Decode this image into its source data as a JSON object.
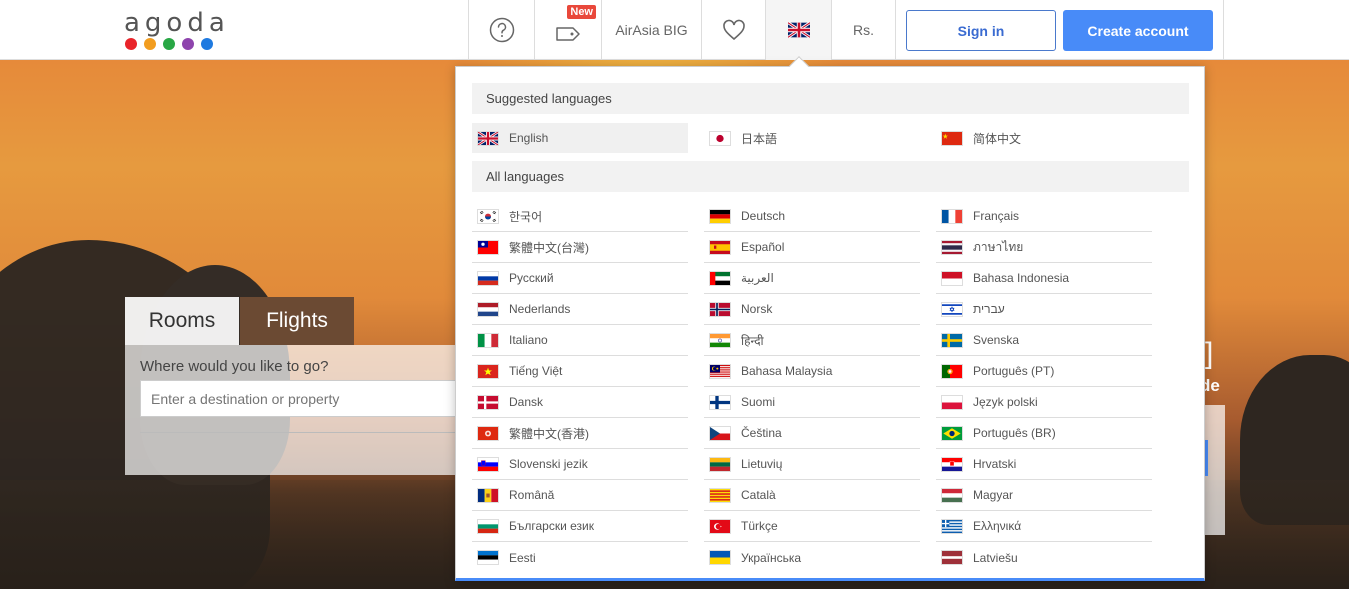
{
  "header": {
    "logo": "agoda",
    "logo_dot_colors": [
      "#e9242a",
      "#f29d1f",
      "#28a745",
      "#8e44ad",
      "#1f7ae0"
    ],
    "help_icon": "question-icon",
    "deals_icon": "tag-icon",
    "deals_badge": "New",
    "airasia_label": "AirAsia BIG",
    "favorites_icon": "heart-icon",
    "language_icon": "uk-flag-icon",
    "currency_label": "Rs.",
    "signin_label": "Sign in",
    "create_label": "Create account"
  },
  "search": {
    "tabs": [
      "Rooms",
      "Flights"
    ],
    "where_label": "Where would you like to go?",
    "destination_placeholder": "Enter a destination or property"
  },
  "hero_right": {
    "text1": "]",
    "text2": "de"
  },
  "dropdown": {
    "suggested_title": "Suggested languages",
    "all_title": "All languages",
    "suggested": [
      {
        "label": "English",
        "flag": "gb",
        "selected": true
      },
      {
        "label": "日本語",
        "flag": "jp"
      },
      {
        "label": "简体中文",
        "flag": "cn"
      }
    ],
    "columns": [
      [
        {
          "label": "한국어",
          "flag": "kr"
        },
        {
          "label": "繁體中文(台灣)",
          "flag": "tw"
        },
        {
          "label": "Русский",
          "flag": "ru"
        },
        {
          "label": "Nederlands",
          "flag": "nl"
        },
        {
          "label": "Italiano",
          "flag": "it"
        },
        {
          "label": "Tiếng Việt",
          "flag": "vn"
        },
        {
          "label": "Dansk",
          "flag": "dk"
        },
        {
          "label": "繁體中文(香港)",
          "flag": "hk"
        },
        {
          "label": "Slovenski jezik",
          "flag": "si"
        },
        {
          "label": "Română",
          "flag": "ro"
        },
        {
          "label": "Български език",
          "flag": "bg"
        },
        {
          "label": "Eesti",
          "flag": "ee"
        }
      ],
      [
        {
          "label": "Deutsch",
          "flag": "de"
        },
        {
          "label": "Español",
          "flag": "es"
        },
        {
          "label": "العربية",
          "flag": "ae"
        },
        {
          "label": "Norsk",
          "flag": "no"
        },
        {
          "label": "हिन्दी",
          "flag": "in"
        },
        {
          "label": "Bahasa Malaysia",
          "flag": "my"
        },
        {
          "label": "Suomi",
          "flag": "fi"
        },
        {
          "label": "Čeština",
          "flag": "cz"
        },
        {
          "label": "Lietuvių",
          "flag": "lt"
        },
        {
          "label": "Català",
          "flag": "ct"
        },
        {
          "label": "Türkçe",
          "flag": "tr"
        },
        {
          "label": "Українська",
          "flag": "ua"
        }
      ],
      [
        {
          "label": "Français",
          "flag": "fr"
        },
        {
          "label": "ภาษาไทย",
          "flag": "th"
        },
        {
          "label": "Bahasa Indonesia",
          "flag": "id"
        },
        {
          "label": "עברית",
          "flag": "il"
        },
        {
          "label": "Svenska",
          "flag": "se"
        },
        {
          "label": "Português (PT)",
          "flag": "pt"
        },
        {
          "label": "Język polski",
          "flag": "pl"
        },
        {
          "label": "Português (BR)",
          "flag": "br"
        },
        {
          "label": "Hrvatski",
          "flag": "hr"
        },
        {
          "label": "Magyar",
          "flag": "hu"
        },
        {
          "label": "Ελληνικά",
          "flag": "gr"
        },
        {
          "label": "Latviešu",
          "flag": "lv"
        }
      ]
    ]
  }
}
